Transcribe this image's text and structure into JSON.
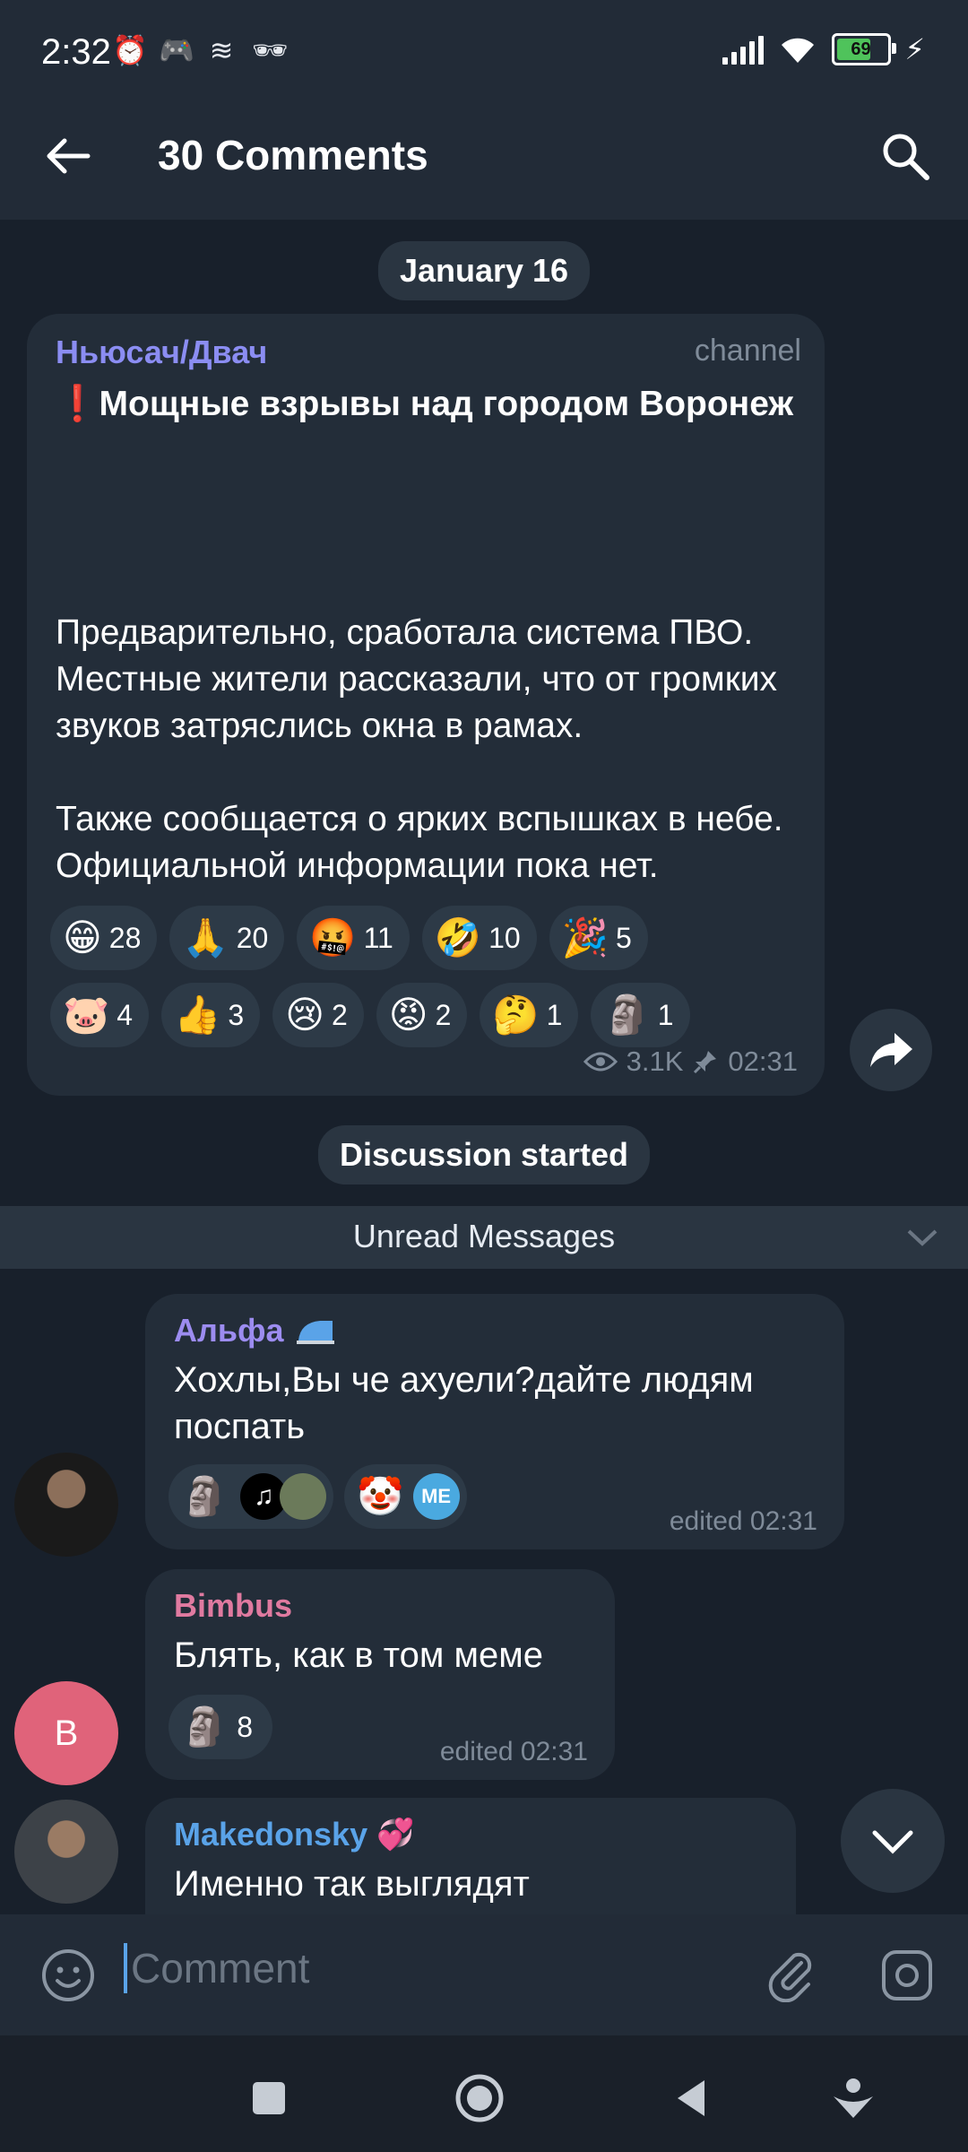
{
  "status_bar": {
    "time": "2:32",
    "battery": "69"
  },
  "header": {
    "title": "30 Comments"
  },
  "date_pill": "January 16",
  "post": {
    "author": "Ньюсач/Двач",
    "channel_label": "channel",
    "headline": "❗Мощные взрывы над городом Воронеж",
    "body": "Предварительно, сработала система ПВО. Местные жители рассказали, что от громких звуков затряслись окна в рамах.\n\nТакже сообщается о ярких вспышках в небе. Официальной информации пока нет.",
    "reactions_row1": [
      {
        "emoji": "😁",
        "count": "28"
      },
      {
        "emoji": "🙏",
        "count": "20"
      },
      {
        "emoji": "🤬",
        "count": "11"
      },
      {
        "emoji": "🤣",
        "count": "10"
      },
      {
        "emoji": "🎉",
        "count": "5"
      }
    ],
    "reactions_row2": [
      {
        "emoji": "🐷",
        "count": "4"
      },
      {
        "emoji": "👍",
        "count": "3"
      },
      {
        "emoji": "😢",
        "count": "2"
      },
      {
        "emoji": "😡",
        "count": "2"
      },
      {
        "emoji": "🤔",
        "count": "1"
      },
      {
        "emoji": "🗿",
        "count": "1"
      }
    ],
    "views": "3.1K",
    "time": "02:31"
  },
  "discussion_started": "Discussion started",
  "unread_label": "Unread Messages",
  "messages": [
    {
      "name": "Альфа",
      "name_color": "#9c8cf0",
      "text": "Хохлы,Вы че ахуели?дайте людям поспать",
      "reaction1_emoji": "🗿",
      "reaction2_emoji": "🤡",
      "reaction2_avatar": "ME",
      "edited": "edited 02:31"
    },
    {
      "name": "Bimbus",
      "name_color": "#e07aa0",
      "avatar_letter": "B",
      "text": "Блять, как в том меме",
      "reaction_emoji": "🗿",
      "reaction_count": "8",
      "edited": "edited 02:31"
    },
    {
      "name": "Makedonsky",
      "name_color": "#5aa3e8",
      "text": "Именно так выглядят"
    }
  ],
  "composer": {
    "placeholder": "Comment"
  }
}
